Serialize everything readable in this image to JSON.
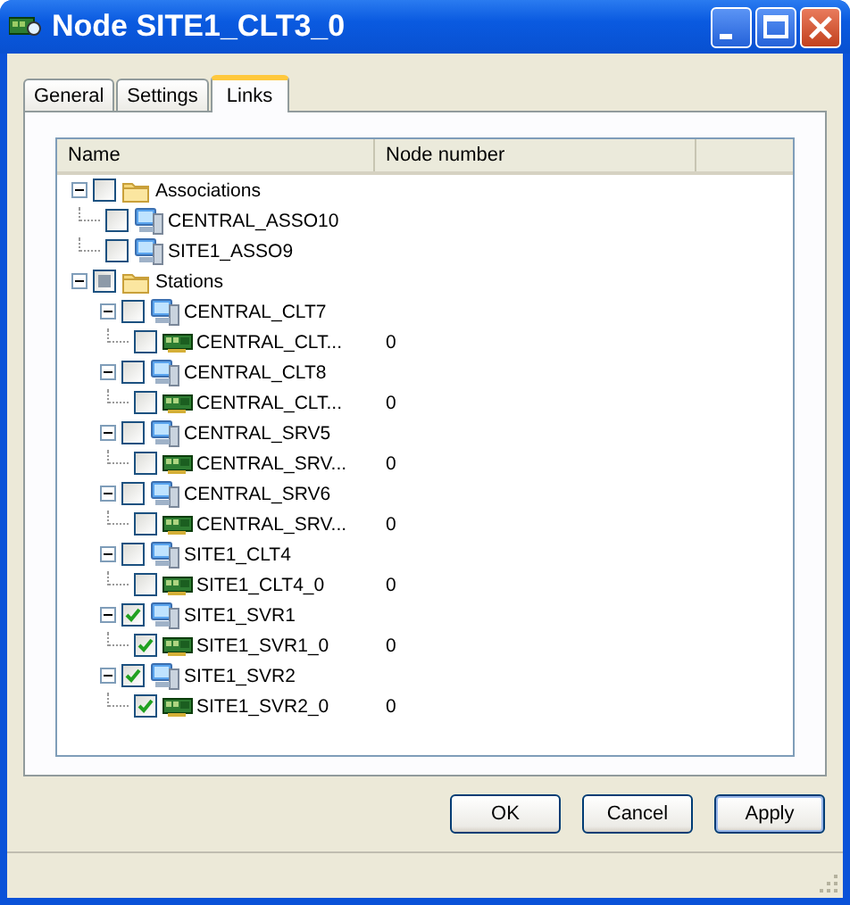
{
  "window": {
    "title": "Node SITE1_CLT3_0"
  },
  "tabs": [
    {
      "label": "General",
      "selected": false
    },
    {
      "label": "Settings",
      "selected": false
    },
    {
      "label": "Links",
      "selected": true
    }
  ],
  "table": {
    "columns": [
      "Name",
      "Node number"
    ],
    "tree": [
      {
        "kind": "folder",
        "name": "Associations",
        "checked": false,
        "expanded": true,
        "children": [
          {
            "kind": "station",
            "name": "CENTRAL_ASSO10",
            "checked": false
          },
          {
            "kind": "station",
            "name": "SITE1_ASSO9",
            "checked": false
          }
        ]
      },
      {
        "kind": "folder",
        "name": "Stations",
        "checked": false,
        "mixed": true,
        "expanded": true,
        "children": [
          {
            "kind": "station",
            "name": "CENTRAL_CLT7",
            "checked": false,
            "expanded": true,
            "children": [
              {
                "kind": "card",
                "name": "CENTRAL_CLT...",
                "number": "0",
                "checked": false
              }
            ]
          },
          {
            "kind": "station",
            "name": "CENTRAL_CLT8",
            "checked": false,
            "expanded": true,
            "children": [
              {
                "kind": "card",
                "name": "CENTRAL_CLT...",
                "number": "0",
                "checked": false
              }
            ]
          },
          {
            "kind": "station",
            "name": "CENTRAL_SRV5",
            "checked": false,
            "expanded": true,
            "children": [
              {
                "kind": "card",
                "name": "CENTRAL_SRV...",
                "number": "0",
                "checked": false
              }
            ]
          },
          {
            "kind": "station",
            "name": "CENTRAL_SRV6",
            "checked": false,
            "expanded": true,
            "children": [
              {
                "kind": "card",
                "name": "CENTRAL_SRV...",
                "number": "0",
                "checked": false
              }
            ]
          },
          {
            "kind": "station",
            "name": "SITE1_CLT4",
            "checked": false,
            "expanded": true,
            "children": [
              {
                "kind": "card",
                "name": "SITE1_CLT4_0",
                "number": "0",
                "checked": false
              }
            ]
          },
          {
            "kind": "station",
            "name": "SITE1_SVR1",
            "checked": true,
            "expanded": true,
            "children": [
              {
                "kind": "card",
                "name": "SITE1_SVR1_0",
                "number": "0",
                "checked": true
              }
            ]
          },
          {
            "kind": "station",
            "name": "SITE1_SVR2",
            "checked": true,
            "expanded": true,
            "children": [
              {
                "kind": "card",
                "name": "SITE1_SVR2_0",
                "number": "0",
                "checked": true
              }
            ]
          }
        ]
      }
    ]
  },
  "buttons": [
    "OK",
    "Cancel",
    "Apply"
  ]
}
